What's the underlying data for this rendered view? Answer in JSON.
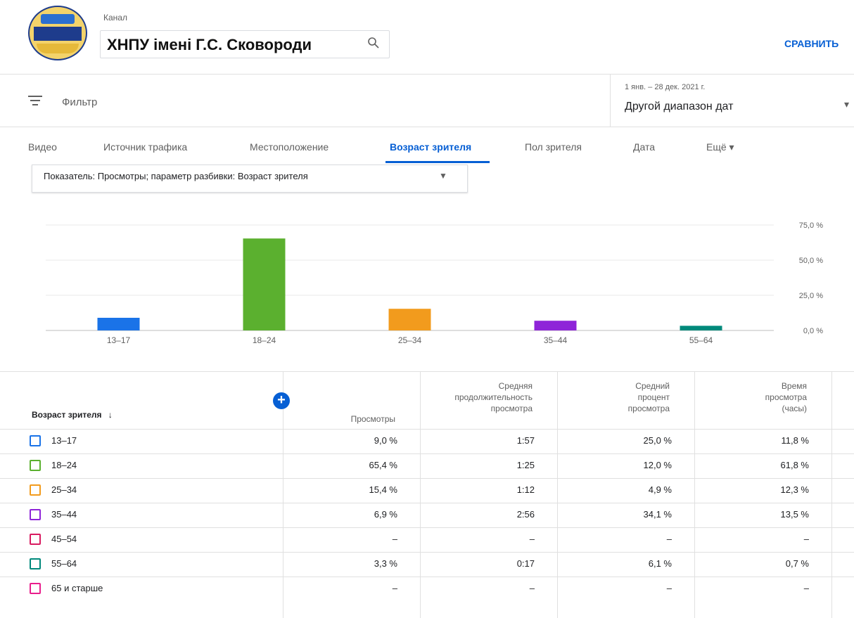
{
  "header": {
    "channel_label": "Канал",
    "channel_name": "ХНПУ імені Г.С. Сковороди",
    "compare_button": "СРАВНИТЬ"
  },
  "filter": {
    "label": "Фильтр",
    "date_range_small": "1 янв. – 28 дек. 2021 г.",
    "date_range": "Другой диапазон дат"
  },
  "tabs": [
    {
      "label": "Видео"
    },
    {
      "label": "Источник трафика"
    },
    {
      "label": "Местоположение"
    },
    {
      "label": "Возраст зрителя",
      "active": true
    },
    {
      "label": "Пол зрителя"
    },
    {
      "label": "Дата"
    },
    {
      "label": "Ещё ▾"
    }
  ],
  "metric_selector": "Показатель: Просмотры; параметр разбивки: Возраст зрителя",
  "chart_data": {
    "type": "bar",
    "categories": [
      "13–17",
      "18–24",
      "25–34",
      "35–44",
      "55–64"
    ],
    "values": [
      9.0,
      65.4,
      15.4,
      6.9,
      3.3
    ],
    "colors": [
      "#1a73e8",
      "#5bb02f",
      "#f29b1d",
      "#8e24d8",
      "#00897b"
    ],
    "y_ticks": [
      "75,0 %",
      "50,0 %",
      "25,0 %",
      "0,0 %"
    ],
    "ylim": [
      0,
      75
    ],
    "grid": true
  },
  "table": {
    "columns": {
      "age": "Возраст зрителя",
      "views": "Просмотры",
      "avg_duration": [
        "Средняя",
        "продолжительность",
        "просмотра"
      ],
      "avg_percent": [
        "Средний",
        "процент",
        "просмотра"
      ],
      "watch_time": [
        "Время",
        "просмотра",
        "(часы)"
      ]
    },
    "rows": [
      {
        "label": "13–17",
        "color": "#1a73e8",
        "views": "9,0 %",
        "duration": "1:57",
        "percent": "25,0 %",
        "watch": "11,8 %"
      },
      {
        "label": "18–24",
        "color": "#5bb02f",
        "views": "65,4 %",
        "duration": "1:25",
        "percent": "12,0 %",
        "watch": "61,8 %"
      },
      {
        "label": "25–34",
        "color": "#f29b1d",
        "views": "15,4 %",
        "duration": "1:12",
        "percent": "4,9 %",
        "watch": "12,3 %"
      },
      {
        "label": "35–44",
        "color": "#8e24d8",
        "views": "6,9 %",
        "duration": "2:56",
        "percent": "34,1 %",
        "watch": "13,5 %"
      },
      {
        "label": "45–54",
        "color": "#d81b60",
        "views": "–",
        "duration": "–",
        "percent": "–",
        "watch": "–"
      },
      {
        "label": "55–64",
        "color": "#00897b",
        "views": "3,3 %",
        "duration": "0:17",
        "percent": "6,1 %",
        "watch": "0,7 %"
      },
      {
        "label": "65 и старше",
        "color": "#e91e8c",
        "views": "–",
        "duration": "–",
        "percent": "–",
        "watch": "–"
      }
    ]
  }
}
